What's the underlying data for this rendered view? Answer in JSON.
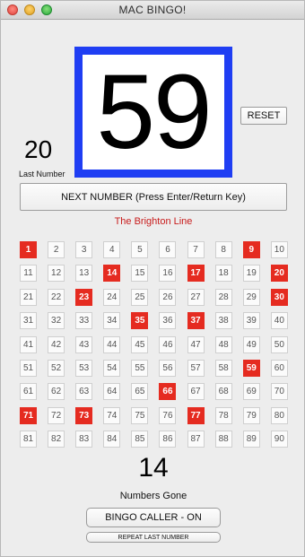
{
  "window": {
    "title": "MAC BINGO!"
  },
  "current_number": "59",
  "reset_label": "RESET",
  "last_number": {
    "value": "20",
    "label": "Last Number"
  },
  "next_button_label": "NEXT NUMBER (Press Enter/Return Key)",
  "call_line": "The Brighton Line",
  "board": {
    "numbers": [
      1,
      2,
      3,
      4,
      5,
      6,
      7,
      8,
      9,
      10,
      11,
      12,
      13,
      14,
      15,
      16,
      17,
      18,
      19,
      20,
      21,
      22,
      23,
      24,
      25,
      26,
      27,
      28,
      29,
      30,
      31,
      32,
      33,
      34,
      35,
      36,
      37,
      38,
      39,
      40,
      41,
      42,
      43,
      44,
      45,
      46,
      47,
      48,
      49,
      50,
      51,
      52,
      53,
      54,
      55,
      56,
      57,
      58,
      59,
      60,
      61,
      62,
      63,
      64,
      65,
      66,
      67,
      68,
      69,
      70,
      71,
      72,
      73,
      74,
      75,
      76,
      77,
      78,
      79,
      80,
      81,
      82,
      83,
      84,
      85,
      86,
      87,
      88,
      89,
      90
    ],
    "called": [
      1,
      9,
      14,
      17,
      20,
      23,
      30,
      35,
      37,
      59,
      66,
      71,
      73,
      77
    ]
  },
  "numbers_gone": {
    "count": "14",
    "label": "Numbers Gone"
  },
  "caller_button_label": "BINGO CALLER - ON",
  "repeat_button_label": "REPEAT LAST NUMBER",
  "colors": {
    "accent_blue": "#1f3ef3",
    "called_red": "#e52b20",
    "call_line_red": "#c81c1c"
  }
}
